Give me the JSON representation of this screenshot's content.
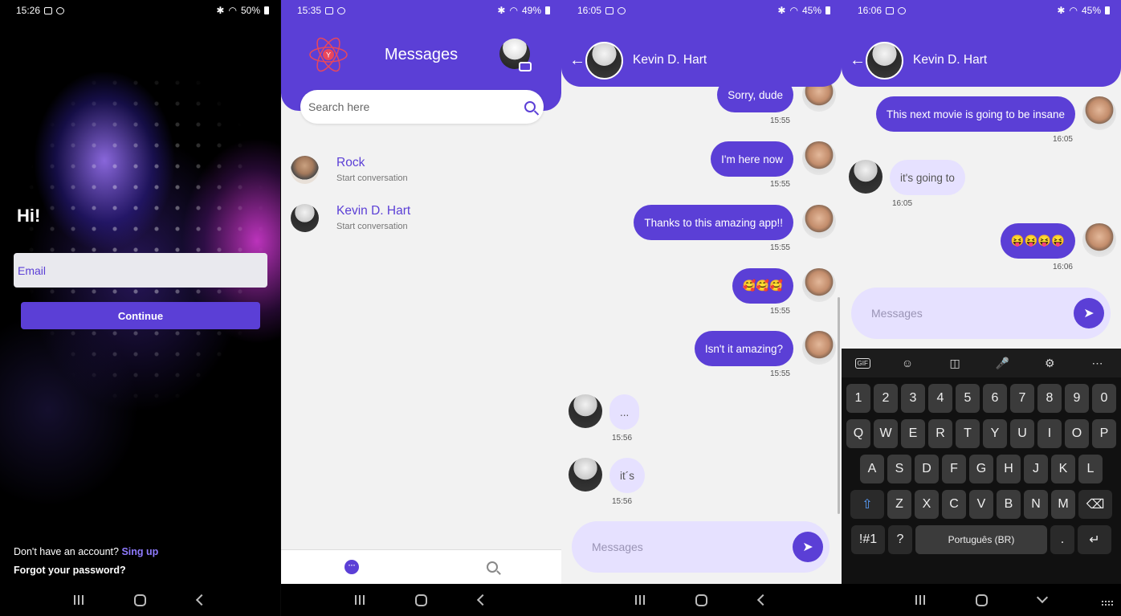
{
  "screens": {
    "login": {
      "status": {
        "time": "15:26",
        "battery": "50%"
      },
      "greeting": "Hi!",
      "email_placeholder": "Email",
      "continue_label": "Continue",
      "no_account_text": "Don't have an account?",
      "signup_link": "Sing up",
      "forgot_password": "Forgot your password?"
    },
    "messages_list": {
      "status": {
        "time": "15:35",
        "battery": "49%"
      },
      "logo_letter": "Y",
      "title": "Messages",
      "search_placeholder": "Search here",
      "conversations": [
        {
          "name": "Rock",
          "subtitle": "Start conversation"
        },
        {
          "name": "Kevin D. Hart",
          "subtitle": "Start conversation"
        }
      ]
    },
    "chat_1": {
      "status": {
        "time": "16:05",
        "battery": "45%"
      },
      "contact_name": "Kevin D. Hart",
      "messages": [
        {
          "text": "Sorry, dude",
          "time": "15:55",
          "direction": "out"
        },
        {
          "text": "I'm here now",
          "time": "15:55",
          "direction": "out"
        },
        {
          "text": "Thanks to this amazing app!!",
          "time": "15:55",
          "direction": "out"
        },
        {
          "text": "🥰🥰🥰",
          "time": "15:55",
          "direction": "out"
        },
        {
          "text": "Isn't it amazing?",
          "time": "15:55",
          "direction": "out"
        },
        {
          "text": "...",
          "time": "15:56",
          "direction": "in"
        },
        {
          "text": "it´s",
          "time": "15:56",
          "direction": "in"
        }
      ],
      "composer_placeholder": "Messages"
    },
    "chat_2": {
      "status": {
        "time": "16:06",
        "battery": "45%"
      },
      "contact_name": "Kevin D. Hart",
      "messages": [
        {
          "text": "This next movie is going to be insane",
          "time": "16:05",
          "direction": "out"
        },
        {
          "text": "it's going to",
          "time": "16:05",
          "direction": "in"
        },
        {
          "text": "😝😝😝😝",
          "time": "16:06",
          "direction": "out"
        }
      ],
      "composer_placeholder": "Messages",
      "keyboard": {
        "numbers": [
          "1",
          "2",
          "3",
          "4",
          "5",
          "6",
          "7",
          "8",
          "9",
          "0"
        ],
        "row1": [
          "Q",
          "W",
          "E",
          "R",
          "T",
          "Y",
          "U",
          "I",
          "O",
          "P"
        ],
        "row2": [
          "A",
          "S",
          "D",
          "F",
          "G",
          "H",
          "J",
          "K",
          "L"
        ],
        "row3": [
          "Z",
          "X",
          "C",
          "V",
          "B",
          "N",
          "M"
        ],
        "symbols_key": "!#1",
        "question_key": "?",
        "space_label": "Português (BR)",
        "period_key": ".",
        "gif_label": "GIF"
      }
    }
  },
  "colors": {
    "accent": "#5b3fd6",
    "incoming_bubble": "#e6e1ff",
    "background": "#f2f2f2"
  },
  "icons": [
    "back-arrow-icon",
    "send-icon",
    "search-icon",
    "chat-icon",
    "camera-icon",
    "atom-logo-icon",
    "emoji-icon",
    "sticker-icon",
    "mic-icon",
    "settings-icon",
    "more-icon",
    "shift-icon",
    "backspace-icon",
    "enter-icon"
  ]
}
